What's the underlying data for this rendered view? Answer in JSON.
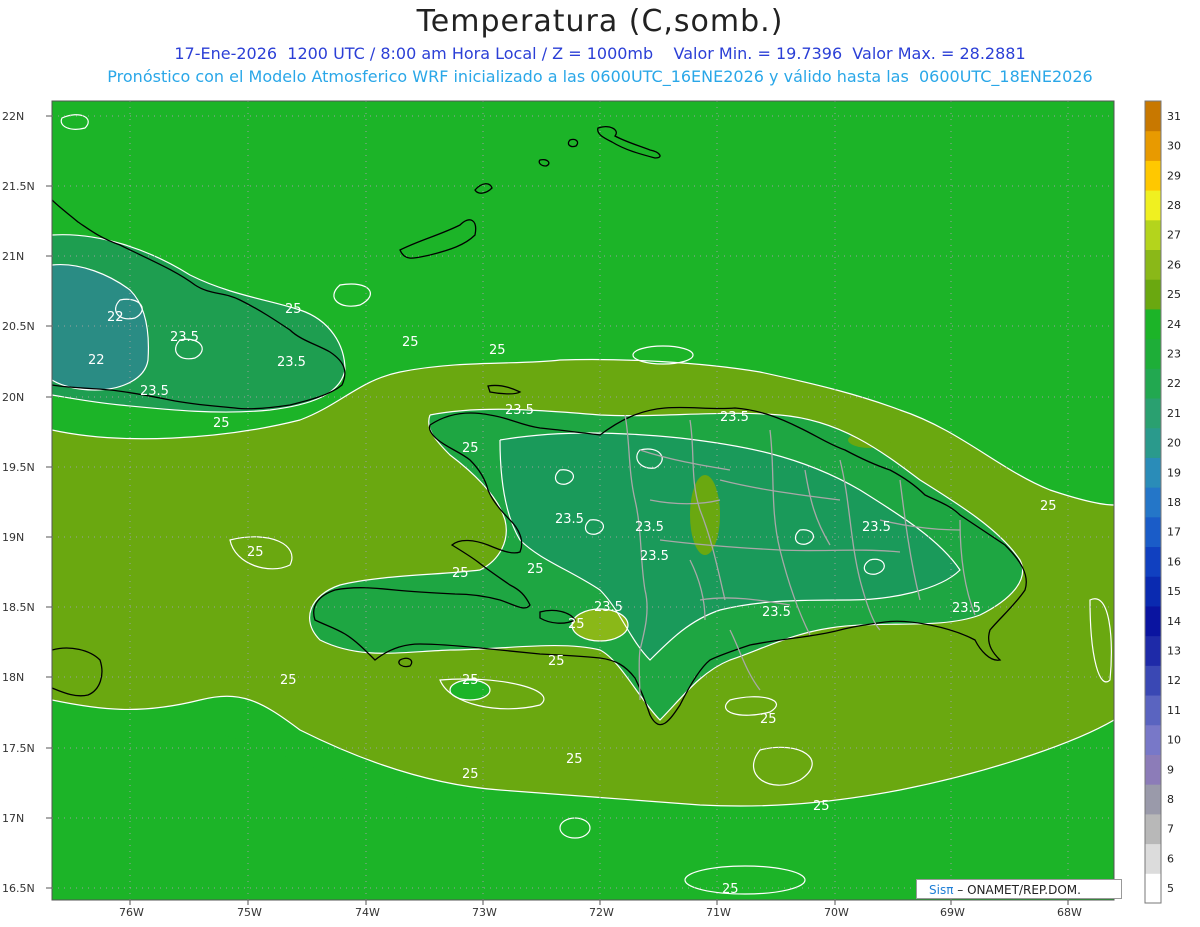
{
  "header": {
    "title": "Temperatura (C,somb.)",
    "subtitle_line1": "17-Ene-2026  1200 UTC / 8:00 am Hora Local / Z = 1000mb    Valor Min. = 19.7396  Valor Max. = 28.2881",
    "subtitle_line2": "Pronóstico con el Modelo Atmosferico WRF inicializado a las 0600UTC_16ENE2026 y válido hasta las  0600UTC_18ENE2026"
  },
  "axes": {
    "lat_labels": [
      "22N",
      "21.5N",
      "21N",
      "20.5N",
      "20N",
      "19.5N",
      "19N",
      "18.5N",
      "18N",
      "17.5N",
      "17N",
      "16.5N"
    ],
    "lon_labels": [
      "76W",
      "75W",
      "74W",
      "73W",
      "72W",
      "71W",
      "70W",
      "69W",
      "68W"
    ]
  },
  "colorbar": {
    "levels": [
      "5",
      "6",
      "7",
      "8",
      "9",
      "10",
      "11",
      "12",
      "13",
      "14",
      "15",
      "16",
      "17",
      "18",
      "19",
      "20",
      "21",
      "22",
      "23",
      "24",
      "25",
      "26",
      "27",
      "28",
      "29",
      "30",
      "31"
    ],
    "colors": [
      "#ffffff",
      "#dcdcdc",
      "#b8b8b8",
      "#9a9aaa",
      "#8c7cb8",
      "#7878c8",
      "#5a64c0",
      "#3a48b4",
      "#1e2aa8",
      "#0a14a0",
      "#0a2ab0",
      "#1040c0",
      "#1a5cc8",
      "#2476c8",
      "#2a8cb8",
      "#2a9a8c",
      "#2aa070",
      "#22a850",
      "#1eae38",
      "#1cb428",
      "#6aa810",
      "#8ab818",
      "#b4d41c",
      "#f0f020",
      "#ffc800",
      "#e89a00",
      "#c87800"
    ]
  },
  "contours": {
    "labels": [
      "25",
      "25",
      "25",
      "25",
      "22",
      "23.5",
      "22",
      "23.5",
      "23.5",
      "25",
      "23.5",
      "25",
      "23.5",
      "23.5",
      "23.5",
      "25",
      "23.5",
      "23.5",
      "23.5",
      "25",
      "25",
      "25",
      "25",
      "23.5",
      "23.5",
      "25",
      "25",
      "25",
      "25",
      "25",
      "25",
      "25"
    ]
  },
  "credit": {
    "brand": "Sisπ",
    "text": " – ONAMET/REP.DOM."
  }
}
